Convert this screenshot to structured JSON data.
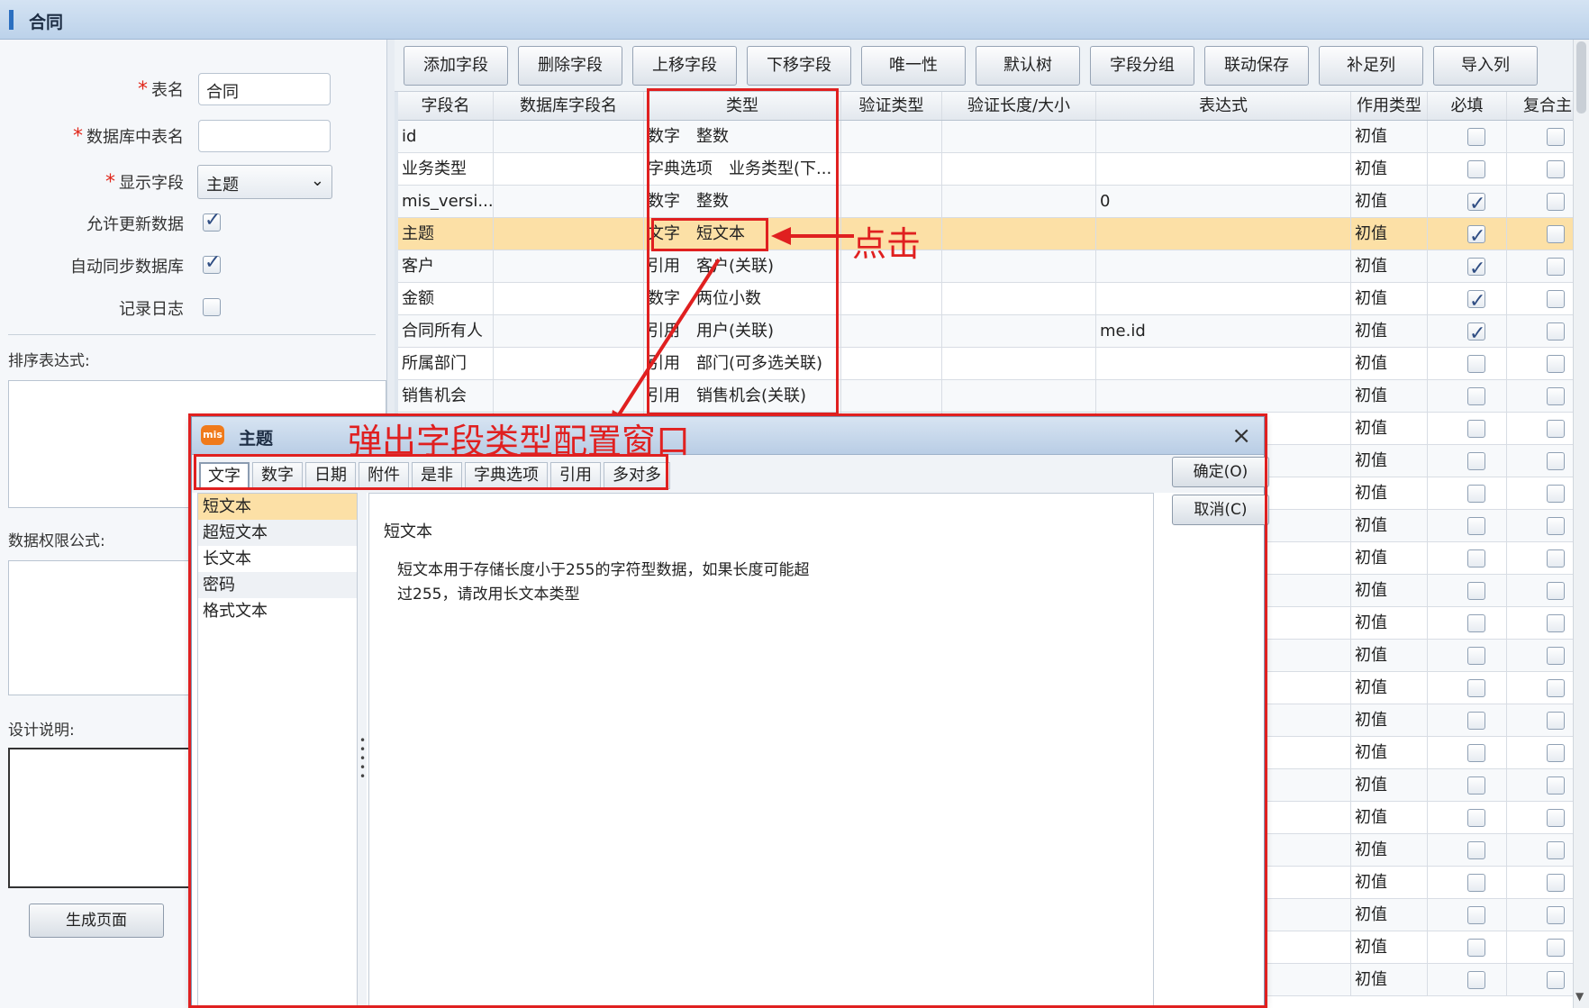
{
  "window": {
    "title": "合同"
  },
  "form": {
    "table_name_label": "表名",
    "table_name_value": "合同",
    "db_table_name_label": "数据库中表名",
    "db_table_name_value": "",
    "display_field_label": "显示字段",
    "display_field_value": "主题",
    "allow_update_label": "允许更新数据",
    "allow_update_checked": true,
    "auto_sync_label": "自动同步数据库",
    "auto_sync_checked": true,
    "log_label": "记录日志",
    "log_checked": false,
    "sort_expr_label": "排序表达式:",
    "data_perm_label": "数据权限公式:",
    "design_note_label": "设计说明:",
    "generate_button": "生成页面"
  },
  "toolbar": {
    "buttons": [
      "添加字段",
      "删除字段",
      "上移字段",
      "下移字段",
      "唯一性",
      "默认树",
      "字段分组",
      "联动保存",
      "补足列",
      "导入列"
    ]
  },
  "grid": {
    "columns": [
      "字段名",
      "数据库字段名",
      "类型",
      "验证类型",
      "验证长度/大小",
      "表达式",
      "作用类型",
      "必填",
      "复合主"
    ],
    "rows": [
      {
        "name": "id",
        "db": "",
        "type1": "数字",
        "type2": "整数",
        "expr": "",
        "action": "初值",
        "required": false
      },
      {
        "name": "业务类型",
        "db": "",
        "type1": "字典选项",
        "type2": "业务类型(下...",
        "expr": "",
        "action": "初值",
        "required": false
      },
      {
        "name": "mis_versi...",
        "db": "",
        "type1": "数字",
        "type2": "整数",
        "expr": "0",
        "action": "初值",
        "required": true
      },
      {
        "name": "主题",
        "db": "",
        "type1": "文字",
        "type2": "短文本",
        "expr": "",
        "action": "初值",
        "required": true
      },
      {
        "name": "客户",
        "db": "",
        "type1": "引用",
        "type2": "客户(关联)",
        "expr": "",
        "action": "初值",
        "required": true
      },
      {
        "name": "金额",
        "db": "",
        "type1": "数字",
        "type2": "两位小数",
        "expr": "",
        "action": "初值",
        "required": true
      },
      {
        "name": "合同所有人",
        "db": "",
        "type1": "引用",
        "type2": "用户(关联)",
        "expr": "me.id",
        "action": "初值",
        "required": true
      },
      {
        "name": "所属部门",
        "db": "",
        "type1": "引用",
        "type2": "部门(可多选关联)",
        "expr": "",
        "action": "初值",
        "required": false
      },
      {
        "name": "销售机会",
        "db": "",
        "type1": "引用",
        "type2": "销售机会(关联)",
        "expr": "",
        "action": "初值",
        "required": false
      }
    ],
    "filler_action": "初值",
    "selected_row": 3
  },
  "annotations": {
    "click": "点击",
    "popup": "弹出字段类型配置窗口"
  },
  "dialog": {
    "title": "主题",
    "logo": "mis",
    "close_glyph": "×",
    "tabs": [
      "文字",
      "数字",
      "日期",
      "附件",
      "是非",
      "字典选项",
      "引用",
      "多对多"
    ],
    "active_tab": 0,
    "types": [
      "短文本",
      "超短文本",
      "长文本",
      "密码",
      "格式文本"
    ],
    "selected_type": 0,
    "heading": "短文本",
    "description": "短文本用于存储长度小于255的字符型数据，如果长度可能超过255，请改用长文本类型",
    "ok_button": "确定(O)",
    "cancel_button": "取消(C)"
  }
}
